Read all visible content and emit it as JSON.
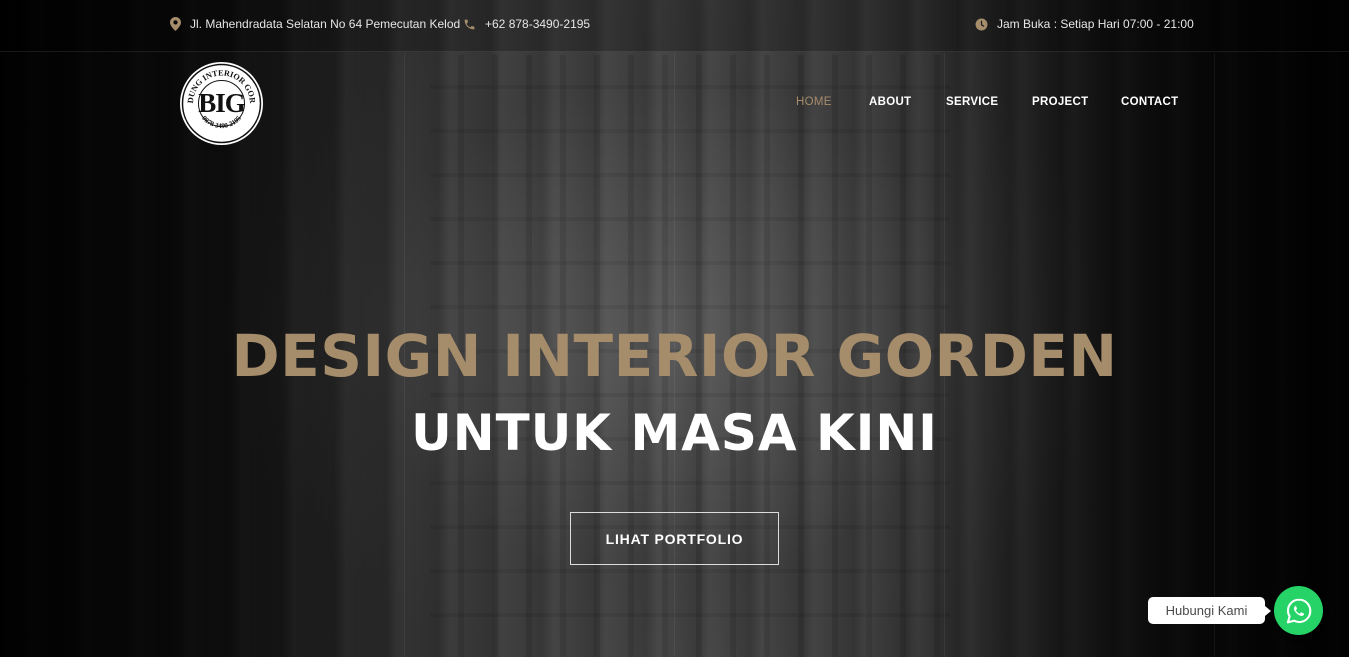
{
  "topbar": {
    "address": "Jl. Mahendradata Selatan No 64 Pemecutan Kelod",
    "phone": "+62 878-3490-2195",
    "hours": "Jam Buka : Setiap Hari 07:00 - 21:00",
    "icons": [
      "map-pin-icon",
      "phone-icon",
      "clock-icon"
    ],
    "icon_color": "#a58c6b"
  },
  "logo": {
    "mark": "BIG",
    "ring_text": "BANDUNG INTERIOR GORDEN",
    "phone_text": "0878 3490 2195"
  },
  "nav": {
    "items": [
      {
        "label": "HOME",
        "active": true
      },
      {
        "label": "ABOUT",
        "active": false
      },
      {
        "label": "SERVICE",
        "active": false
      },
      {
        "label": "PROJECT",
        "active": false
      },
      {
        "label": "CONTACT",
        "active": false
      }
    ],
    "active_color": "#a58c6b"
  },
  "hero": {
    "title": "DESIGN INTERIOR GORDEN",
    "subtitle": "UNTUK MASA KINI",
    "cta_label": "LIHAT PORTFOLIO",
    "accent_color": "#a58c6b"
  },
  "whatsapp": {
    "bubble_label": "Hubungi Kami",
    "icon": "whatsapp-icon",
    "color": "#25d366"
  }
}
